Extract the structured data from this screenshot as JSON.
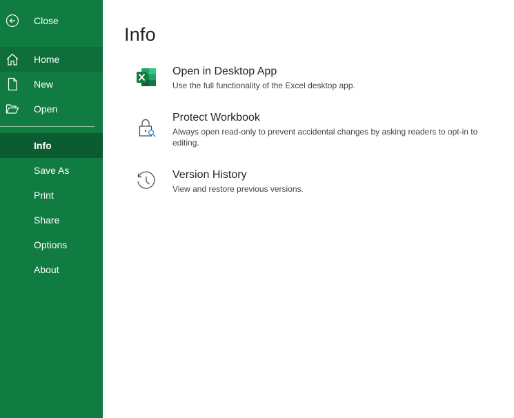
{
  "sidebar": {
    "close_label": "Close",
    "items": [
      {
        "label": "Home",
        "icon": "home-icon"
      },
      {
        "label": "New",
        "icon": "new-document-icon"
      },
      {
        "label": "Open",
        "icon": "folder-open-icon"
      },
      {
        "label": "Info"
      },
      {
        "label": "Save As"
      },
      {
        "label": "Print"
      },
      {
        "label": "Share"
      },
      {
        "label": "Options"
      },
      {
        "label": "About"
      }
    ],
    "active": "Info",
    "bg_color": "#107c41"
  },
  "main": {
    "title": "Info",
    "items": [
      {
        "title": "Open in Desktop App",
        "description": "Use the full functionality of the Excel desktop app.",
        "icon": "excel-logo-icon"
      },
      {
        "title": "Protect Workbook",
        "description": "Always open read-only to prevent accidental changes by asking readers to opt-in to editing.",
        "icon": "lock-search-icon"
      },
      {
        "title": "Version History",
        "description": "View and restore previous versions.",
        "icon": "history-clock-icon"
      }
    ]
  }
}
